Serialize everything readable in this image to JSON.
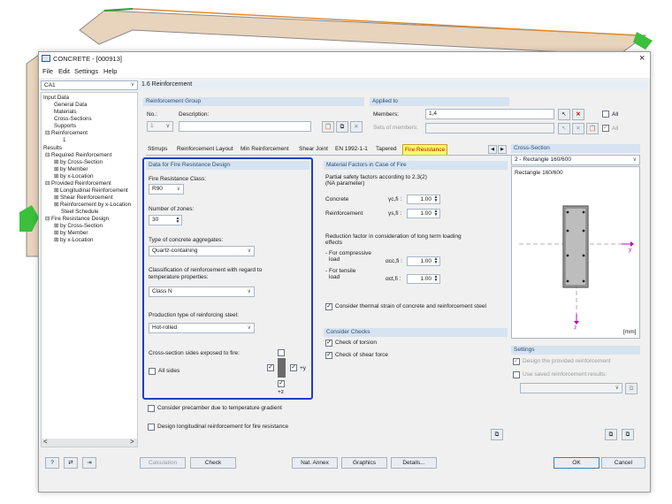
{
  "window": {
    "title": "CONCRETE - [000913]",
    "close": "×"
  },
  "menu": [
    "File",
    "Edit",
    "Settings",
    "Help"
  ],
  "case_select": "CA1",
  "section_title": "1.6 Reinforcement",
  "tree": {
    "input_header": "Input Data",
    "input_items": [
      "General Data",
      "Materials",
      "Cross-Sections",
      "Supports",
      "Reinforcement",
      "1"
    ],
    "results_header": "Results",
    "results_items": [
      "Required Reinforcement",
      "by Cross-Section",
      "by Member",
      "by x-Location",
      "Provided Reinforcement",
      "Longitudinal Reinforcement",
      "Shear Reinforcement",
      "Reinforcement by x-Location",
      "Steel Schedule",
      "Fire Resistance Design",
      "by Cross-Section",
      "by Member",
      "by x-Location"
    ]
  },
  "reinforcement_group": {
    "header": "Reinforcement Group",
    "no_label": "No.:",
    "no_value": "1",
    "desc_label": "Description:",
    "desc_value": ""
  },
  "applied_to": {
    "header": "Applied to",
    "members_label": "Members:",
    "members_value": "1,4",
    "sets_label": "Sets of members:",
    "all_label": "All"
  },
  "tabs": [
    "Stirrups",
    "Reinforcement Layout",
    "Min Reinforcement",
    "Shear Joint",
    "EN 1992-1-1",
    "Tapered",
    "Fire Resistance"
  ],
  "fire": {
    "header": "Data for Fire Resistance Design",
    "class_label": "Fire Resistance Class:",
    "class_value": "R90",
    "zones_label": "Number of zones:",
    "zones_value": "30",
    "aggregates_label": "Type of concrete aggregates:",
    "aggregates_value": "Quartz-containing",
    "classification_label_1": "Classification of reinforcement with regard to",
    "classification_label_2": "temperature properties:",
    "classification_value": "Class N",
    "production_label": "Production type of reinforcing steel:",
    "production_value": "Hot-rolled",
    "sides_label": "Cross-section sides exposed to fire:",
    "all_sides_label": "All sides",
    "plus_y": "+y",
    "plus_z": "+z"
  },
  "material_factors": {
    "header": "Material Factors in Case of Fire",
    "desc_1": "Partial safety factors according to 2.3(2)",
    "desc_2": "(NA parameter)",
    "concrete_label": "Concrete",
    "concrete_sym": "γc,fi :",
    "concrete_val": "1.00",
    "reinf_label": "Reinforcement",
    "reinf_sym": "γs,fi :",
    "reinf_val": "1.00",
    "reduction_1": "Reduction factor in consideration of long term loading",
    "reduction_2": "effects",
    "comp_1": "- For compressive",
    "comp_2": "load",
    "comp_sym": "αcc,fi :",
    "comp_val": "1.00",
    "tens_1": "- For tensile",
    "tens_2": "load",
    "tens_sym": "αct,fi :",
    "tens_val": "1.00",
    "thermal": "Consider thermal strain of concrete and reinforcement steel"
  },
  "consider_checks": {
    "header": "Consider Checks",
    "torsion": "Check of torsion",
    "shear": "Check of shear force"
  },
  "options": {
    "precamber": "Consider precamber due to temperature gradient",
    "longitudinal": "Design longitudinal reinforcement for fire resistance"
  },
  "cross_section": {
    "header": "Cross-Section",
    "value": "2 - Rectangle 160/600",
    "name": "Rectangle 160/600",
    "unit": "[mm]",
    "y": "y",
    "z": "z"
  },
  "settings": {
    "header": "Settings",
    "design_provided": "Design the provided reinforcement",
    "use_saved": "Use saved reinforcement results:"
  },
  "buttons": {
    "calculation": "Calculation",
    "check": "Check",
    "nat_annex": "Nat. Annex",
    "graphics": "Graphics",
    "details": "Details...",
    "ok": "OK",
    "cancel": "Cancel"
  },
  "colors": {
    "accent": "#1f3fbf",
    "tab_active": "#ffff66",
    "panel_head": "#d6e3f0"
  }
}
